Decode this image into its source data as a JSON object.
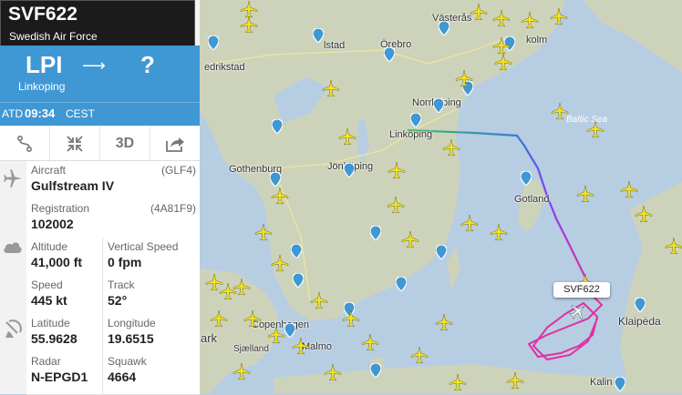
{
  "flight": {
    "callsign": "SVF622",
    "operator": "Swedish Air Force",
    "origin_code": "LPI",
    "origin_arrow": "⟶",
    "destination_code": "?",
    "origin_city": "Linkoping",
    "atd_label": "ATD",
    "atd_time": "09:34",
    "atd_tz": "CEST"
  },
  "toolbar": {
    "three_d_label": "3D"
  },
  "details": {
    "aircraft_label": "Aircraft",
    "aircraft_code": "(GLF4)",
    "aircraft_value": "Gulfstream IV",
    "registration_label": "Registration",
    "registration_code": "(4A81F9)",
    "registration_value": "102002",
    "altitude_label": "Altitude",
    "altitude_value": "41,000 ft",
    "vspeed_label": "Vertical Speed",
    "vspeed_value": "0 fpm",
    "speed_label": "Speed",
    "speed_value": "445 kt",
    "track_label": "Track",
    "track_value": "52°",
    "latitude_label": "Latitude",
    "latitude_value": "55.9628",
    "longitude_label": "Longitude",
    "longitude_value": "19.6515",
    "radar_label": "Radar",
    "radar_value": "N-EPGD1",
    "squawk_label": "Squawk",
    "squawk_value": "4664"
  },
  "map": {
    "labels": {
      "vasteras": "Västerås",
      "stockholm": "kolm",
      "karlstad": "lstad",
      "orebro": "Örebro",
      "fredrikstad": "edrikstad",
      "norrkoping": "Norrköping",
      "linkoping": "Linköping",
      "baltic": "Baltic Sea",
      "gothenburg": "Gothenburg",
      "jonkoping": "Jönköping",
      "gotland": "Gotland",
      "copenhagen": "Copenhagen",
      "malmo": "Malmo",
      "sjaelland": "Sjælland",
      "klaipeda": "Klaipėda",
      "kaliningrad": "Kalin",
      "mark": "ark"
    },
    "tag_label": "SVF622"
  },
  "colors": {
    "panel_blue": "#3f97d3",
    "title_bg": "#1b1b1b",
    "land": "#ccd3b9",
    "sea": "#b7cde2",
    "plane": "#f5e31b"
  }
}
